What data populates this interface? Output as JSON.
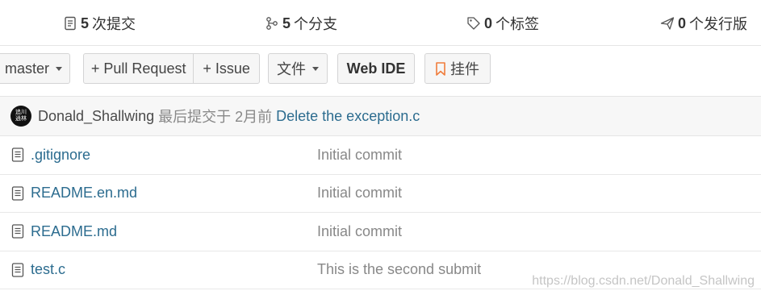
{
  "stats": {
    "commits": {
      "num": "5",
      "label": "次提交",
      "icon": "commit-icon"
    },
    "branches": {
      "num": "5",
      "label": "个分支",
      "icon": "branch-icon"
    },
    "tags": {
      "num": "0",
      "label": "个标签",
      "icon": "tag-icon"
    },
    "releases": {
      "num": "0",
      "label": "个发行版",
      "icon": "release-icon"
    }
  },
  "toolbar": {
    "branch": "master",
    "pull_request": "+ Pull Request",
    "issue": "+ Issue",
    "files": "文件",
    "web_ide": "Web IDE",
    "widget": "挂件",
    "widget_icon_color": "#f07d3c"
  },
  "commit": {
    "avatar_text": "追川\n逍林",
    "author": "Donald_Shallwing",
    "meta": "最后提交于 2月前",
    "message": "Delete the exception.c"
  },
  "files": [
    {
      "name": ".gitignore",
      "message": "Initial commit"
    },
    {
      "name": "README.en.md",
      "message": "Initial commit"
    },
    {
      "name": "README.md",
      "message": "Initial commit"
    },
    {
      "name": "test.c",
      "message": "This is the second submit"
    }
  ],
  "watermark": "https://blog.csdn.net/Donald_Shallwing"
}
